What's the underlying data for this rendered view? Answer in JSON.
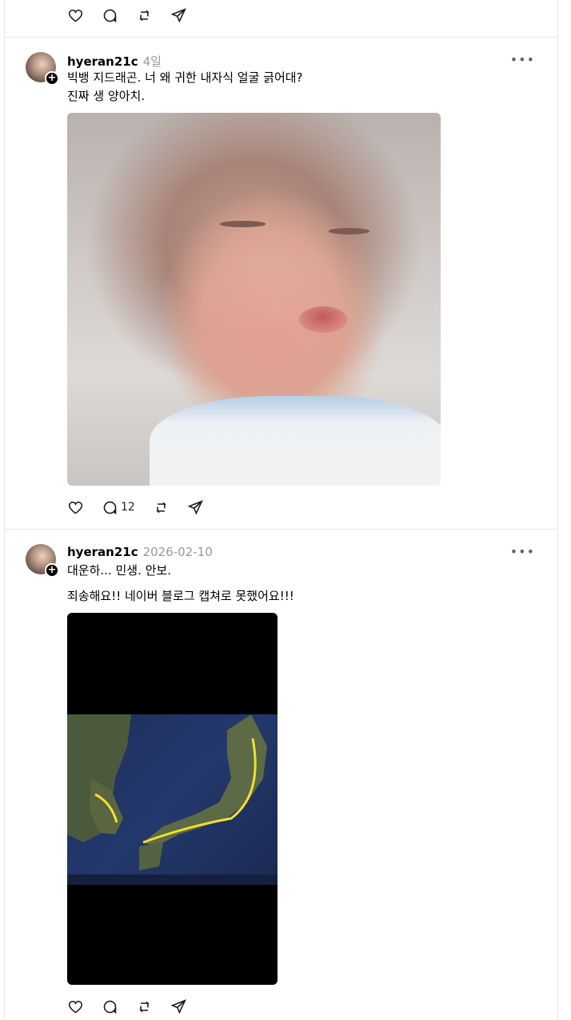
{
  "posts": [
    {
      "username": "hyeran21c",
      "time": "4일",
      "more": "•••",
      "lines": [
        "빅뱅 지드래곤. 너 왜 귀한 내자식 얼굴 긁어대?",
        "진짜 생 양아치."
      ],
      "reply_count": "12"
    },
    {
      "username": "hyeran21c",
      "time": "2026-02-10",
      "more": "•••",
      "lines": [
        "대운하... 민생. 안보.",
        "죄송해요!! 네이버 블로그 캡쳐로 못했어요!!!"
      ],
      "reply_count": ""
    }
  ],
  "icons": [
    "heart-icon",
    "comment-icon",
    "repost-icon",
    "share-icon"
  ]
}
